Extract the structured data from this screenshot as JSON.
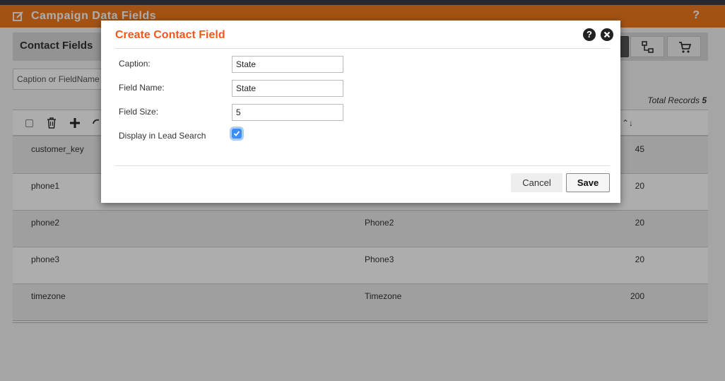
{
  "app": {
    "title": "Campaign Data Fields",
    "help": "?"
  },
  "panel": {
    "label": "Contact Fields",
    "search_placeholder": "Caption or FieldName"
  },
  "table": {
    "total_label": "Total Records",
    "total_count": "5",
    "rows": [
      {
        "name": "customer_key",
        "caption": "",
        "size": "45"
      },
      {
        "name": "phone1",
        "caption": "",
        "size": "20"
      },
      {
        "name": "phone2",
        "caption": "Phone2",
        "size": "20"
      },
      {
        "name": "phone3",
        "caption": "Phone3",
        "size": "20"
      },
      {
        "name": "timezone",
        "caption": "Timezone",
        "size": "200"
      }
    ]
  },
  "modal": {
    "title": "Create Contact Field",
    "help_icon": "?",
    "fields": {
      "caption_label": "Caption:",
      "caption_value": "State",
      "field_name_label": "Field Name:",
      "field_name_value": "State",
      "field_size_label": "Field Size:",
      "field_size_value": "5",
      "display_label": "Display in Lead Search",
      "display_checked": true
    },
    "cancel_label": "Cancel",
    "save_label": "Save"
  },
  "colors": {
    "accent": "#f07a1c",
    "modal_title": "#f0591e",
    "checkbox": "#3d8ef2"
  }
}
